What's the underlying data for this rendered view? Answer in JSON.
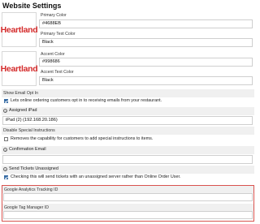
{
  "settings": {
    "title": "Website Settings",
    "logo_text": "Heartland",
    "primary_color": {
      "label": "Primary Color",
      "value": "#4688EB"
    },
    "primary_text_color": {
      "label": "Primary Text Color",
      "value": "Black"
    },
    "accent_color": {
      "label": "Accent Color",
      "value": "#998686"
    },
    "accent_text_color": {
      "label": "Accent Text Color",
      "value": "Black"
    },
    "show_email_opt_in": {
      "label": "Show Email Opt In",
      "checkbox_label": "Lets online ordering customers opt in to receiving emails from your restaurant.",
      "checked": true
    },
    "assigned_ipad": {
      "label": "Assigned iPad",
      "value": "iPad (2) (192.168.20.186)"
    },
    "disable_special_instructions": {
      "label": "Disable Special Instructions",
      "checkbox_label": "Removes the capability for customers to add special instructions to items.",
      "checked": false
    },
    "confirmation_email": {
      "label": "Confirmation Email",
      "value": ""
    },
    "send_tickets_unassigned": {
      "label": "Send Tickets Unassigned",
      "checkbox_label": "Checking this will send tickets with an unassigned server rather than Online Order User.",
      "checked": true
    },
    "google_analytics": {
      "label": "Google Analytics Tracking ID",
      "value": ""
    },
    "google_tag_manager": {
      "label": "Google Tag Manager ID",
      "value": ""
    }
  },
  "colors": {
    "logo_red": "#d42a2a",
    "highlight_border": "#d9534f",
    "section_bg": "#f0f0f0"
  }
}
